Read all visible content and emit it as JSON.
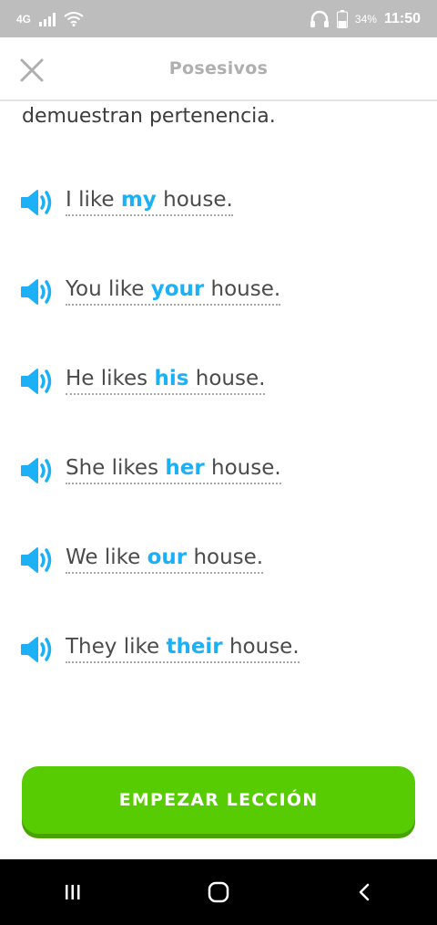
{
  "status_bar": {
    "network": "4G",
    "battery_percent": "34%",
    "time": "11:50"
  },
  "header": {
    "title": "Posesivos"
  },
  "intro_text": "demuestran pertenencia.",
  "examples": [
    {
      "before": "I like ",
      "highlight": "my",
      "after": " house."
    },
    {
      "before": "You like ",
      "highlight": "your",
      "after": " house."
    },
    {
      "before": "He likes ",
      "highlight": "his",
      "after": " house."
    },
    {
      "before": "She likes ",
      "highlight": "her",
      "after": " house."
    },
    {
      "before": "We like ",
      "highlight": "our",
      "after": " house."
    },
    {
      "before": "They like ",
      "highlight": "their",
      "after": " house."
    }
  ],
  "cta": {
    "label": "EMPEZAR LECCIÓN"
  },
  "colors": {
    "accent_blue": "#1cb0f6",
    "button_green": "#58cc02",
    "button_shadow": "#46a302"
  },
  "icons": {
    "close": "close-icon",
    "speaker": "speaker-icon",
    "nav_recents": "recents-icon",
    "nav_home": "home-icon",
    "nav_back": "back-icon"
  }
}
